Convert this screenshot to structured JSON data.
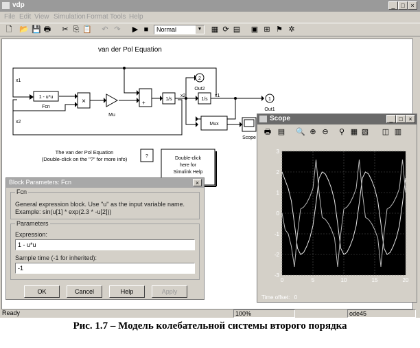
{
  "window": {
    "title": "vdp",
    "menus": [
      "File",
      "Edit",
      "View",
      "Simulation",
      "Format",
      "Tools",
      "Help"
    ],
    "toolbar": {
      "sim_mode": "Normal"
    },
    "status": {
      "left": "Ready",
      "zoom": "100%",
      "solver": "ode45"
    }
  },
  "model": {
    "title": "van der Pol Equation",
    "blocks": {
      "fcn_text": "1 - u*u",
      "fcn_label": "Fcn",
      "product": "×",
      "mu_label": "Mu",
      "sum_plus": "+",
      "int1": "1/s",
      "int2": "1/s",
      "out2_num": "2",
      "out2_label": "Out2",
      "out1_num": "1",
      "out1_label": "Out1",
      "mux": "Mux",
      "scope_label": "Scope",
      "x1_sig": "x1",
      "x2_sig": "x2",
      "x1_top": "x1",
      "x2_left": "x2",
      "x1_left": "x1"
    },
    "info_text_1": "The van der Pol Equation",
    "info_text_2": "(Double-click on the \"?\" for more info)",
    "help_q": "?",
    "help_box": [
      "Double-click",
      "here for",
      "Simulink Help"
    ]
  },
  "scope": {
    "title": "Scope",
    "time_offset_label": "Time offset:",
    "time_offset_value": "0",
    "chart_data": {
      "type": "line",
      "xlim": [
        0,
        20
      ],
      "ylim": [
        -3,
        3
      ],
      "x_ticks": [
        "0",
        "5",
        "10",
        "15",
        "20"
      ],
      "y_ticks": [
        "3",
        "2",
        "1",
        "0",
        "-1",
        "-2",
        "-3"
      ],
      "grid": true,
      "series": [
        {
          "x": [
            0,
            0.5,
            1,
            1.5,
            2,
            2.5,
            3,
            3.5,
            4,
            4.5,
            5,
            5.5,
            6,
            6.5,
            7,
            7.5,
            8,
            8.5,
            9,
            9.5,
            10,
            10.5,
            11,
            11.5,
            12,
            12.5,
            13,
            13.5,
            14,
            14.5,
            15,
            15.5,
            16,
            16.5,
            17,
            17.5,
            18,
            18.5,
            19,
            19.5,
            20
          ],
          "values": [
            2.0,
            1.6,
            1.2,
            0.6,
            -0.5,
            -1.7,
            -2.0,
            -1.9,
            -1.6,
            -1.2,
            -0.6,
            0.5,
            1.7,
            2.0,
            1.9,
            1.6,
            1.2,
            0.6,
            -0.5,
            -1.7,
            -2.0,
            -1.9,
            -1.6,
            -1.2,
            -0.6,
            0.5,
            1.7,
            2.0,
            1.9,
            1.6,
            1.2,
            0.6,
            -0.5,
            -1.7,
            -2.0,
            -1.9,
            -1.6,
            -1.2,
            -0.6,
            0.5,
            1.7
          ]
        },
        {
          "x": [
            0,
            0.5,
            1,
            1.5,
            2,
            2.5,
            3,
            3.5,
            4,
            4.5,
            5,
            5.5,
            6,
            6.5,
            7,
            7.5,
            8,
            8.5,
            9,
            9.5,
            10,
            10.5,
            11,
            11.5,
            12,
            12.5,
            13,
            13.5,
            14,
            14.5,
            15,
            15.5,
            16,
            16.5,
            17,
            17.5,
            18,
            18.5,
            19,
            19.5,
            20
          ],
          "values": [
            0.0,
            -0.8,
            -1.0,
            -1.6,
            -2.6,
            -1.0,
            0.2,
            0.3,
            0.5,
            0.8,
            1.2,
            2.6,
            1.0,
            -0.2,
            -0.3,
            -0.5,
            -0.8,
            -1.2,
            -2.6,
            -1.0,
            0.2,
            0.3,
            0.5,
            0.8,
            1.2,
            2.6,
            1.0,
            -0.2,
            -0.3,
            -0.5,
            -0.8,
            -1.2,
            -2.6,
            -1.0,
            0.2,
            0.3,
            0.5,
            0.8,
            1.2,
            2.6,
            1.0
          ]
        }
      ]
    }
  },
  "dialog": {
    "title": "Block Parameters: Fcn",
    "group1_title": "Fcn",
    "desc_1": "General expression block. Use \"u\" as the input variable name.",
    "desc_2": "Example: sin(u[1] * exp(2.3 * -u[2]))",
    "group2_title": "Parameters",
    "expression_label": "Expression:",
    "expression_value": "1 - u*u",
    "sample_label": "Sample time (-1 for inherited):",
    "sample_value": "-1",
    "buttons": [
      "OK",
      "Cancel",
      "Help",
      "Apply"
    ]
  },
  "caption": "Рис. 1.7 – Модель колебательной системы второго порядка"
}
